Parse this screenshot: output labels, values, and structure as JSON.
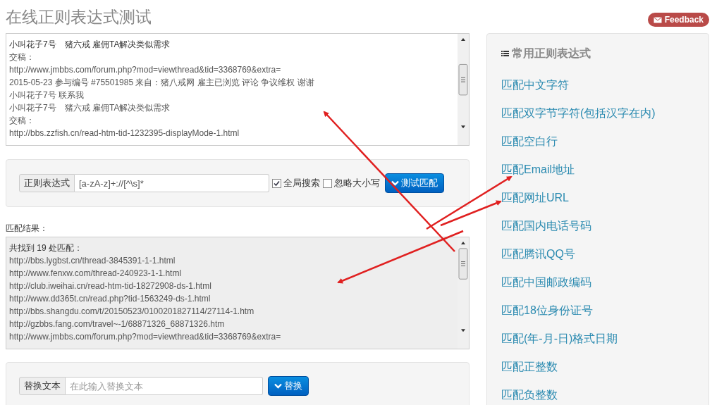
{
  "page": {
    "title": "在线正则表达式测试",
    "feedback": "Feedback"
  },
  "source_text": {
    "lines": [
      "小叫花子7号　猪六戒  雇佣TA解决类似需求",
      "交稿：",
      "http://www.jmbbs.com/forum.php?mod=viewthread&tid=3368769&extra=",
      "2015-05-23 参与编号 #75501985 来自：猪八戒网 雇主已浏览 评论 争议维权 谢谢",
      "小叫花子7号 联系我",
      "小叫花子7号　猪六戒  雇佣TA解决类似需求",
      "交稿：",
      "http://bbs.zzfish.cn/read-htm-tid-1232395-displayMode-1.html"
    ]
  },
  "regex_form": {
    "label": "正则表达式",
    "value": "[a-zA-z]+://[^\\s]*",
    "options": [
      {
        "label": "全局搜索",
        "checked": true
      },
      {
        "label": "忽略大小写",
        "checked": false
      }
    ],
    "button": "测试匹配"
  },
  "result": {
    "label": "匹配结果：",
    "lines": [
      "共找到 19 处匹配：",
      "http://bbs.lygbst.cn/thread-3845391-1-1.html",
      "http://www.fenxw.com/thread-240923-1-1.html",
      "http://club.iweihai.cn/read-htm-tid-18272908-ds-1.html",
      "http://www.dd365t.cn/read.php?tid-1563249-ds-1.html",
      "http://bbs.shangdu.com/t/20150523/0100201827114/27114-1.htm",
      "http://gzbbs.fang.com/travel~-1/68871326_68871326.htm",
      "http://www.jmbbs.com/forum.php?mod=viewthread&tid=3368769&extra="
    ]
  },
  "replace_form": {
    "label": "替换文本",
    "placeholder": "在此输入替换文本",
    "button": "替换"
  },
  "sidebar": {
    "title": "常用正则表达式",
    "items": [
      "匹配中文字符",
      "匹配双字节字符(包括汉字在内)",
      "匹配空白行",
      "匹配Email地址",
      "匹配网址URL",
      "匹配国内电话号码",
      "匹配腾讯QQ号",
      "匹配中国邮政编码",
      "匹配18位身份证号",
      "匹配(年-月-日)格式日期",
      "匹配正整数",
      "匹配负整数"
    ]
  }
}
